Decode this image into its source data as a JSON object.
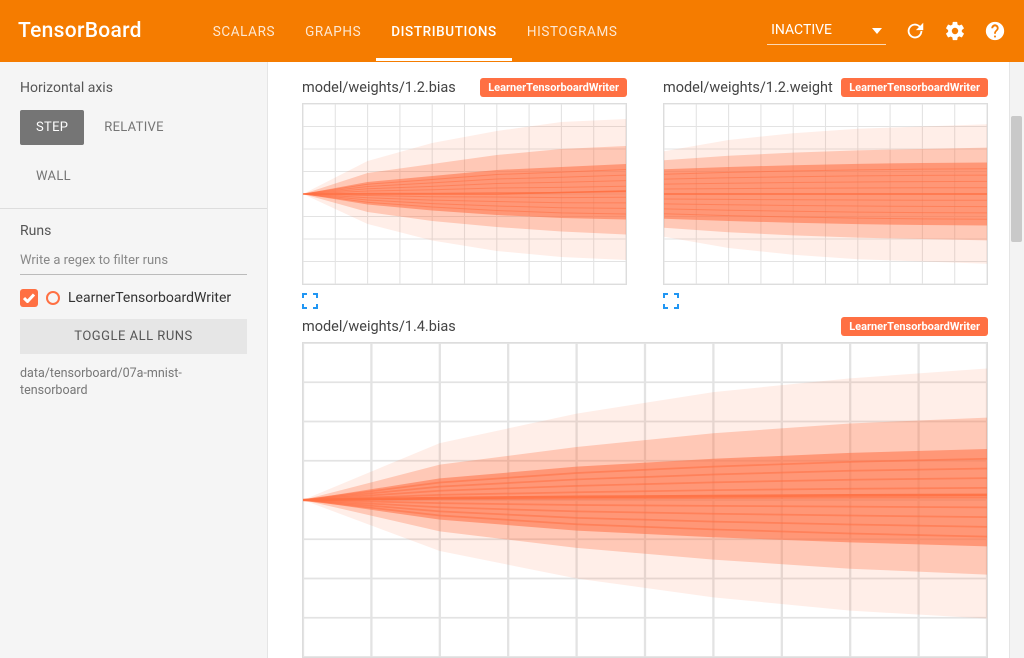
{
  "header": {
    "brand": "TensorBoard",
    "tabs": [
      "SCALARS",
      "GRAPHS",
      "DISTRIBUTIONS",
      "HISTOGRAMS"
    ],
    "active_tab": 2,
    "dropdown_label": "INACTIVE"
  },
  "sidebar": {
    "axis_label": "Horizontal axis",
    "axis_options": [
      "STEP",
      "RELATIVE",
      "WALL"
    ],
    "axis_active": 0,
    "runs_label": "Runs",
    "filter_placeholder": "Write a regex to filter runs",
    "runs": [
      {
        "name": "LearnerTensorboardWriter",
        "checked": true
      }
    ],
    "toggle_all_label": "TOGGLE ALL RUNS",
    "data_path": "data/tensorboard/07a-mnist-tensorboard"
  },
  "charts": [
    {
      "title": "model/weights/1.2.bias",
      "badge": "LearnerTensorboardWriter",
      "size": "small"
    },
    {
      "title": "model/weights/1.2.weight",
      "badge": "LearnerTensorboardWriter",
      "size": "small"
    },
    {
      "title": "model/weights/1.4.bias",
      "badge": "LearnerTensorboardWriter",
      "size": "large"
    }
  ],
  "chart_data": [
    {
      "type": "area",
      "title": "model/weights/1.2.bias",
      "x": [
        0,
        200,
        400,
        600,
        800,
        1000
      ],
      "percentiles": {
        "p99": [
          0.0,
          0.11,
          0.17,
          0.21,
          0.24,
          0.25
        ],
        "p93": [
          0.0,
          0.07,
          0.1,
          0.13,
          0.15,
          0.16
        ],
        "p84": [
          0.0,
          0.04,
          0.06,
          0.08,
          0.09,
          0.1
        ],
        "p50": [
          0.0,
          0.0,
          0.0,
          0.0,
          0.005,
          0.01
        ],
        "p16": [
          0.0,
          -0.035,
          -0.055,
          -0.07,
          -0.08,
          -0.085
        ],
        "p7": [
          0.0,
          -0.06,
          -0.09,
          -0.11,
          -0.125,
          -0.135
        ],
        "p1": [
          0.0,
          -0.1,
          -0.155,
          -0.19,
          -0.21,
          -0.22
        ]
      },
      "xlim": [
        0,
        1000
      ],
      "ylim": [
        -0.3,
        0.3
      ]
    },
    {
      "type": "area",
      "title": "model/weights/1.2.weight",
      "x": [
        0,
        200,
        400,
        600,
        800,
        1000
      ],
      "percentiles": {
        "p99": [
          0.095,
          0.12,
          0.135,
          0.145,
          0.15,
          0.155
        ],
        "p93": [
          0.075,
          0.085,
          0.092,
          0.097,
          0.1,
          0.103
        ],
        "p84": [
          0.055,
          0.06,
          0.064,
          0.067,
          0.069,
          0.07
        ],
        "p50": [
          0.0,
          0.0,
          0.0,
          0.0,
          0.0,
          0.0
        ],
        "p16": [
          -0.055,
          -0.06,
          -0.064,
          -0.067,
          -0.069,
          -0.07
        ],
        "p7": [
          -0.075,
          -0.085,
          -0.092,
          -0.097,
          -0.1,
          -0.103
        ],
        "p1": [
          -0.095,
          -0.12,
          -0.135,
          -0.145,
          -0.15,
          -0.155
        ]
      },
      "xlim": [
        0,
        1000
      ],
      "ylim": [
        -0.2,
        0.2
      ]
    },
    {
      "type": "area",
      "title": "model/weights/1.4.bias",
      "x": [
        0,
        200,
        400,
        600,
        800,
        1000
      ],
      "percentiles": {
        "p99": [
          0.0,
          0.145,
          0.22,
          0.275,
          0.31,
          0.335
        ],
        "p93": [
          0.0,
          0.09,
          0.135,
          0.17,
          0.195,
          0.21
        ],
        "p84": [
          0.0,
          0.055,
          0.085,
          0.105,
          0.12,
          0.13
        ],
        "p50": [
          0.0,
          0.005,
          0.008,
          0.01,
          0.012,
          0.013
        ],
        "p16": [
          0.0,
          -0.05,
          -0.078,
          -0.095,
          -0.108,
          -0.118
        ],
        "p7": [
          0.0,
          -0.08,
          -0.122,
          -0.152,
          -0.175,
          -0.19
        ],
        "p1": [
          0.0,
          -0.13,
          -0.2,
          -0.248,
          -0.282,
          -0.302
        ]
      },
      "xlim": [
        0,
        1000
      ],
      "ylim": [
        -0.4,
        0.4
      ]
    }
  ]
}
